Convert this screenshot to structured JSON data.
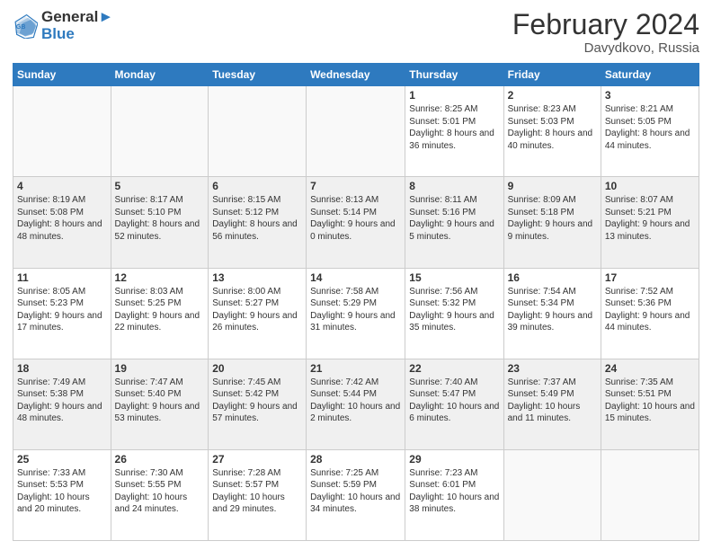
{
  "header": {
    "logo_line1": "General",
    "logo_line2": "Blue",
    "month_year": "February 2024",
    "location": "Davydkovo, Russia"
  },
  "weekdays": [
    "Sunday",
    "Monday",
    "Tuesday",
    "Wednesday",
    "Thursday",
    "Friday",
    "Saturday"
  ],
  "weeks": [
    [
      {
        "day": "",
        "sunrise": "",
        "sunset": "",
        "daylight": ""
      },
      {
        "day": "",
        "sunrise": "",
        "sunset": "",
        "daylight": ""
      },
      {
        "day": "",
        "sunrise": "",
        "sunset": "",
        "daylight": ""
      },
      {
        "day": "",
        "sunrise": "",
        "sunset": "",
        "daylight": ""
      },
      {
        "day": "1",
        "sunrise": "Sunrise: 8:25 AM",
        "sunset": "Sunset: 5:01 PM",
        "daylight": "Daylight: 8 hours and 36 minutes."
      },
      {
        "day": "2",
        "sunrise": "Sunrise: 8:23 AM",
        "sunset": "Sunset: 5:03 PM",
        "daylight": "Daylight: 8 hours and 40 minutes."
      },
      {
        "day": "3",
        "sunrise": "Sunrise: 8:21 AM",
        "sunset": "Sunset: 5:05 PM",
        "daylight": "Daylight: 8 hours and 44 minutes."
      }
    ],
    [
      {
        "day": "4",
        "sunrise": "Sunrise: 8:19 AM",
        "sunset": "Sunset: 5:08 PM",
        "daylight": "Daylight: 8 hours and 48 minutes."
      },
      {
        "day": "5",
        "sunrise": "Sunrise: 8:17 AM",
        "sunset": "Sunset: 5:10 PM",
        "daylight": "Daylight: 8 hours and 52 minutes."
      },
      {
        "day": "6",
        "sunrise": "Sunrise: 8:15 AM",
        "sunset": "Sunset: 5:12 PM",
        "daylight": "Daylight: 8 hours and 56 minutes."
      },
      {
        "day": "7",
        "sunrise": "Sunrise: 8:13 AM",
        "sunset": "Sunset: 5:14 PM",
        "daylight": "Daylight: 9 hours and 0 minutes."
      },
      {
        "day": "8",
        "sunrise": "Sunrise: 8:11 AM",
        "sunset": "Sunset: 5:16 PM",
        "daylight": "Daylight: 9 hours and 5 minutes."
      },
      {
        "day": "9",
        "sunrise": "Sunrise: 8:09 AM",
        "sunset": "Sunset: 5:18 PM",
        "daylight": "Daylight: 9 hours and 9 minutes."
      },
      {
        "day": "10",
        "sunrise": "Sunrise: 8:07 AM",
        "sunset": "Sunset: 5:21 PM",
        "daylight": "Daylight: 9 hours and 13 minutes."
      }
    ],
    [
      {
        "day": "11",
        "sunrise": "Sunrise: 8:05 AM",
        "sunset": "Sunset: 5:23 PM",
        "daylight": "Daylight: 9 hours and 17 minutes."
      },
      {
        "day": "12",
        "sunrise": "Sunrise: 8:03 AM",
        "sunset": "Sunset: 5:25 PM",
        "daylight": "Daylight: 9 hours and 22 minutes."
      },
      {
        "day": "13",
        "sunrise": "Sunrise: 8:00 AM",
        "sunset": "Sunset: 5:27 PM",
        "daylight": "Daylight: 9 hours and 26 minutes."
      },
      {
        "day": "14",
        "sunrise": "Sunrise: 7:58 AM",
        "sunset": "Sunset: 5:29 PM",
        "daylight": "Daylight: 9 hours and 31 minutes."
      },
      {
        "day": "15",
        "sunrise": "Sunrise: 7:56 AM",
        "sunset": "Sunset: 5:32 PM",
        "daylight": "Daylight: 9 hours and 35 minutes."
      },
      {
        "day": "16",
        "sunrise": "Sunrise: 7:54 AM",
        "sunset": "Sunset: 5:34 PM",
        "daylight": "Daylight: 9 hours and 39 minutes."
      },
      {
        "day": "17",
        "sunrise": "Sunrise: 7:52 AM",
        "sunset": "Sunset: 5:36 PM",
        "daylight": "Daylight: 9 hours and 44 minutes."
      }
    ],
    [
      {
        "day": "18",
        "sunrise": "Sunrise: 7:49 AM",
        "sunset": "Sunset: 5:38 PM",
        "daylight": "Daylight: 9 hours and 48 minutes."
      },
      {
        "day": "19",
        "sunrise": "Sunrise: 7:47 AM",
        "sunset": "Sunset: 5:40 PM",
        "daylight": "Daylight: 9 hours and 53 minutes."
      },
      {
        "day": "20",
        "sunrise": "Sunrise: 7:45 AM",
        "sunset": "Sunset: 5:42 PM",
        "daylight": "Daylight: 9 hours and 57 minutes."
      },
      {
        "day": "21",
        "sunrise": "Sunrise: 7:42 AM",
        "sunset": "Sunset: 5:44 PM",
        "daylight": "Daylight: 10 hours and 2 minutes."
      },
      {
        "day": "22",
        "sunrise": "Sunrise: 7:40 AM",
        "sunset": "Sunset: 5:47 PM",
        "daylight": "Daylight: 10 hours and 6 minutes."
      },
      {
        "day": "23",
        "sunrise": "Sunrise: 7:37 AM",
        "sunset": "Sunset: 5:49 PM",
        "daylight": "Daylight: 10 hours and 11 minutes."
      },
      {
        "day": "24",
        "sunrise": "Sunrise: 7:35 AM",
        "sunset": "Sunset: 5:51 PM",
        "daylight": "Daylight: 10 hours and 15 minutes."
      }
    ],
    [
      {
        "day": "25",
        "sunrise": "Sunrise: 7:33 AM",
        "sunset": "Sunset: 5:53 PM",
        "daylight": "Daylight: 10 hours and 20 minutes."
      },
      {
        "day": "26",
        "sunrise": "Sunrise: 7:30 AM",
        "sunset": "Sunset: 5:55 PM",
        "daylight": "Daylight: 10 hours and 24 minutes."
      },
      {
        "day": "27",
        "sunrise": "Sunrise: 7:28 AM",
        "sunset": "Sunset: 5:57 PM",
        "daylight": "Daylight: 10 hours and 29 minutes."
      },
      {
        "day": "28",
        "sunrise": "Sunrise: 7:25 AM",
        "sunset": "Sunset: 5:59 PM",
        "daylight": "Daylight: 10 hours and 34 minutes."
      },
      {
        "day": "29",
        "sunrise": "Sunrise: 7:23 AM",
        "sunset": "Sunset: 6:01 PM",
        "daylight": "Daylight: 10 hours and 38 minutes."
      },
      {
        "day": "",
        "sunrise": "",
        "sunset": "",
        "daylight": ""
      },
      {
        "day": "",
        "sunrise": "",
        "sunset": "",
        "daylight": ""
      }
    ]
  ]
}
